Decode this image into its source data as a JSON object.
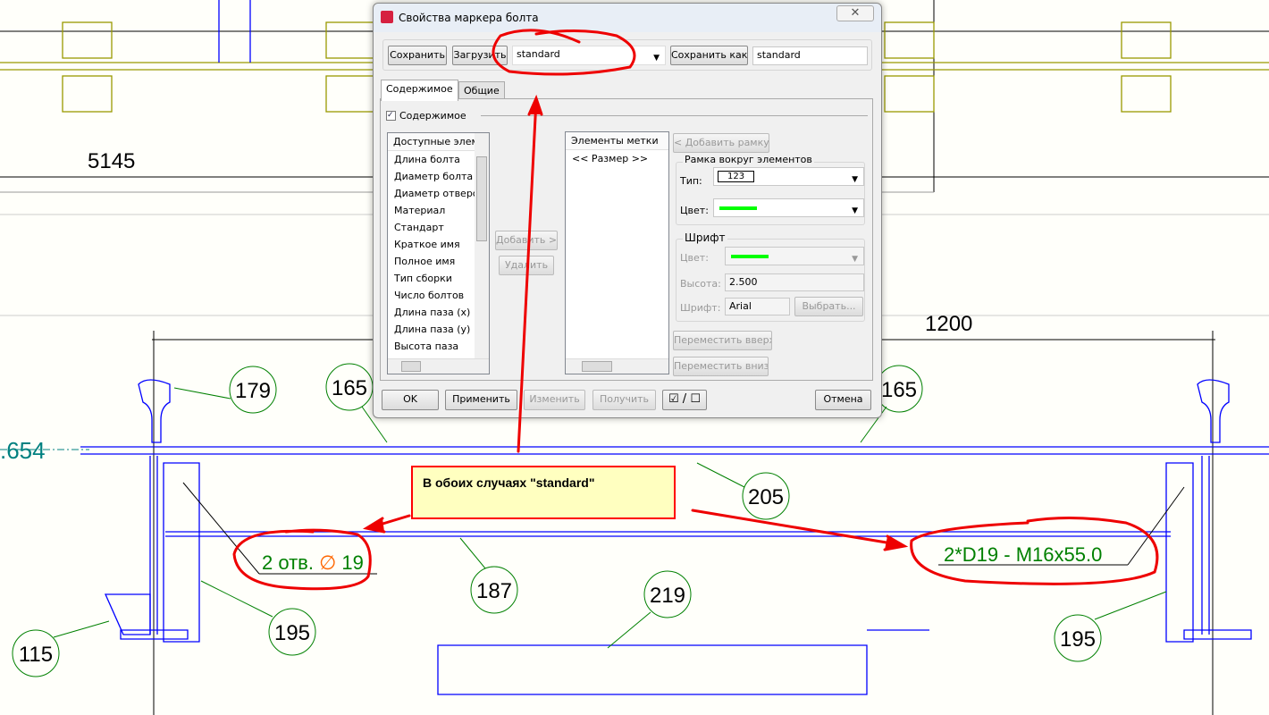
{
  "drawing": {
    "dimensions": [
      "5145",
      "1200",
      ".654"
    ],
    "bubbles": [
      "179",
      "165",
      "165",
      "205",
      "187",
      "195",
      "115",
      "219",
      "195"
    ],
    "labels": {
      "holes_prefix": "2 отв.",
      "holes_symbol": "∅",
      "holes_value": "19",
      "bolt": "2*D19 - M16x55.0"
    },
    "callout": "В обоих случаях \"standard\"",
    "colors": {
      "lines": "#0000ff",
      "bubbles": "#008000",
      "annotation": "#ff0000",
      "callout_bg": "#ffffc0"
    }
  },
  "dialog": {
    "title": "Свойства маркера болта",
    "close": "✕",
    "toolbar": {
      "save": "Сохранить",
      "load": "Загрузить",
      "preset": "standard",
      "save_as": "Сохранить как",
      "save_as_name": "standard"
    },
    "tabs": [
      "Содержимое",
      "Общие"
    ],
    "content_checkbox": "Содержимое",
    "available": {
      "header": "Доступные элем",
      "items": [
        "Длина болта",
        "Диаметр болта",
        "Диаметр отверс",
        "Материал",
        "Стандарт",
        "Краткое имя",
        "Полное имя",
        "Тип сборки",
        "Число болтов",
        "Длина паза (x)",
        "Длина паза (y)",
        "Высота паза"
      ]
    },
    "add": "Добавить >",
    "remove": "Удалить",
    "marker": {
      "header": "Элементы метки",
      "items": [
        "<< Размер >>"
      ]
    },
    "add_frame": "< Добавить рамку",
    "frame": {
      "title": "Рамка вокруг элементов",
      "type_label": "Тип:",
      "type_value": "123",
      "color_label": "Цвет:"
    },
    "font": {
      "title": "Шрифт",
      "color_label": "Цвет:",
      "height_label": "Высота:",
      "height_value": "2.500",
      "font_label": "Шрифт:",
      "font_value": "Arial",
      "choose": "Выбрать..."
    },
    "move_up": "Переместить вверх",
    "move_down": "Переместить вниз",
    "footer": {
      "ok": "OK",
      "apply": "Применить",
      "modify": "Изменить",
      "get": "Получить",
      "toggle": "☑ / ☐",
      "cancel": "Отмена"
    }
  }
}
